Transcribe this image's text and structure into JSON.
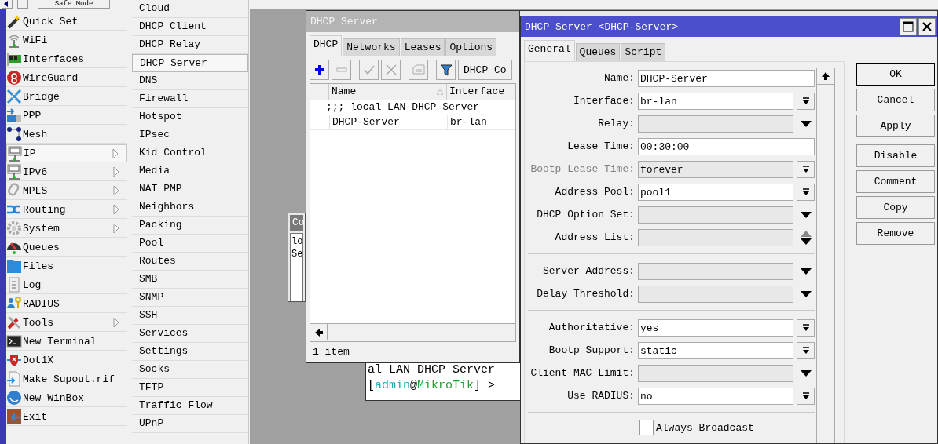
{
  "toolbar": {
    "safe_mode": "Safe Mode"
  },
  "main_menu": [
    {
      "label": "Quick Set",
      "has_submenu": false,
      "selected": false
    },
    {
      "label": "WiFi",
      "has_submenu": false,
      "selected": false
    },
    {
      "label": "Interfaces",
      "has_submenu": false,
      "selected": false
    },
    {
      "label": "WireGuard",
      "has_submenu": false,
      "selected": false
    },
    {
      "label": "Bridge",
      "has_submenu": false,
      "selected": false
    },
    {
      "label": "PPP",
      "has_submenu": false,
      "selected": false
    },
    {
      "label": "Mesh",
      "has_submenu": false,
      "selected": false
    },
    {
      "label": "IP",
      "has_submenu": true,
      "selected": true
    },
    {
      "label": "IPv6",
      "has_submenu": true,
      "selected": false
    },
    {
      "label": "MPLS",
      "has_submenu": true,
      "selected": false
    },
    {
      "label": "Routing",
      "has_submenu": true,
      "selected": false
    },
    {
      "label": "System",
      "has_submenu": true,
      "selected": false
    },
    {
      "label": "Queues",
      "has_submenu": false,
      "selected": false
    },
    {
      "label": "Files",
      "has_submenu": false,
      "selected": false
    },
    {
      "label": "Log",
      "has_submenu": false,
      "selected": false
    },
    {
      "label": "RADIUS",
      "has_submenu": false,
      "selected": false
    },
    {
      "label": "Tools",
      "has_submenu": true,
      "selected": false
    },
    {
      "label": "New Terminal",
      "has_submenu": false,
      "selected": false
    },
    {
      "label": "Dot1X",
      "has_submenu": false,
      "selected": false
    },
    {
      "label": "Make Supout.rif",
      "has_submenu": false,
      "selected": false
    },
    {
      "label": "New WinBox",
      "has_submenu": false,
      "selected": false
    },
    {
      "label": "Exit",
      "has_submenu": false,
      "selected": false
    }
  ],
  "submenu": [
    {
      "label": "Cloud",
      "selected": false
    },
    {
      "label": "DHCP Client",
      "selected": false
    },
    {
      "label": "DHCP Relay",
      "selected": false
    },
    {
      "label": "DHCP Server",
      "selected": true
    },
    {
      "label": "DNS",
      "selected": false
    },
    {
      "label": "Firewall",
      "selected": false
    },
    {
      "label": "Hotspot",
      "selected": false
    },
    {
      "label": "IPsec",
      "selected": false
    },
    {
      "label": "Kid Control",
      "selected": false
    },
    {
      "label": "Media",
      "selected": false
    },
    {
      "label": "NAT PMP",
      "selected": false
    },
    {
      "label": "Neighbors",
      "selected": false
    },
    {
      "label": "Packing",
      "selected": false
    },
    {
      "label": "Pool",
      "selected": false
    },
    {
      "label": "Routes",
      "selected": false
    },
    {
      "label": "SMB",
      "selected": false
    },
    {
      "label": "SNMP",
      "selected": false
    },
    {
      "label": "SSH",
      "selected": false
    },
    {
      "label": "Services",
      "selected": false
    },
    {
      "label": "Settings",
      "selected": false
    },
    {
      "label": "Socks",
      "selected": false
    },
    {
      "label": "TFTP",
      "selected": false
    },
    {
      "label": "Traffic Flow",
      "selected": false
    },
    {
      "label": "UPnP",
      "selected": false
    }
  ],
  "comment_window": {
    "title": "Co",
    "lines": [
      "lo",
      "Se"
    ]
  },
  "terminal": {
    "lines": [
      [
        {
          "text": "al LAN DHCP Server"
        }
      ],
      [
        {
          "text": "["
        },
        {
          "text": "admin",
          "color": "#1ba8b0"
        },
        {
          "text": "@"
        },
        {
          "text": "MikroTik",
          "color": "#22a032"
        },
        {
          "text": "] >"
        }
      ]
    ]
  },
  "list_window": {
    "title": "DHCP Server",
    "tabs": [
      {
        "label": "DHCP",
        "selected": true
      },
      {
        "label": "Networks",
        "selected": false
      },
      {
        "label": "Leases",
        "selected": false
      },
      {
        "label": "Options",
        "selected": false
      }
    ],
    "tool_buttons": [
      {
        "disabled": false
      },
      {
        "disabled": true
      },
      {
        "disabled": true
      },
      {
        "disabled": true
      },
      {
        "disabled": true
      },
      {
        "disabled": false
      }
    ],
    "toolbar_button": "DHCP Co",
    "columns": [
      "Name",
      "Interface"
    ],
    "rows": [
      {
        "kind": "comment",
        "text": ";;; local LAN DHCP Server"
      },
      {
        "kind": "entry",
        "cells": [
          "DHCP-Server",
          "br-lan"
        ]
      }
    ],
    "status": "1 item"
  },
  "dialog": {
    "title": "DHCP Server <DHCP-Server>",
    "tabs": [
      {
        "label": "General",
        "selected": true
      },
      {
        "label": "Queues",
        "selected": false
      },
      {
        "label": "Script",
        "selected": false
      }
    ],
    "groups": [
      [
        {
          "label": "Name:",
          "kind": "text",
          "value": "DHCP-Server",
          "disabled": false
        },
        {
          "label": "Interface:",
          "kind": "combo",
          "value": "br-lan",
          "disabled": false
        },
        {
          "label": "Relay:",
          "kind": "optional",
          "disabled": false
        },
        {
          "label": "Lease Time:",
          "kind": "text",
          "value": "00:30:00",
          "disabled": false
        },
        {
          "label": "Bootp Lease Time:",
          "kind": "combo",
          "value": "forever",
          "disabled": true
        },
        {
          "label": "Address Pool:",
          "kind": "combo",
          "value": "pool1",
          "disabled": false
        },
        {
          "label": "DHCP Option Set:",
          "kind": "optional",
          "disabled": false
        },
        {
          "label": "Address List:",
          "kind": "list",
          "disabled": false
        }
      ],
      [
        {
          "label": "Server Address:",
          "kind": "optional",
          "disabled": false
        },
        {
          "label": "Delay Threshold:",
          "kind": "optional",
          "disabled": false
        }
      ],
      [
        {
          "label": "Authoritative:",
          "kind": "combo",
          "value": "yes",
          "disabled": false
        },
        {
          "label": "Bootp Support:",
          "kind": "combo",
          "value": "static",
          "disabled": false
        },
        {
          "label": "Client MAC Limit:",
          "kind": "optional",
          "disabled": false
        },
        {
          "label": "Use RADIUS:",
          "kind": "combo",
          "value": "no",
          "disabled": false
        }
      ]
    ],
    "checkbox": {
      "label": "Always Broadcast",
      "checked": false
    },
    "buttons": [
      {
        "label": "OK",
        "default": true
      },
      {
        "label": "Cancel",
        "default": false
      },
      {
        "label": "Apply",
        "default": false
      },
      {
        "label": "Disable",
        "default": false
      },
      {
        "label": "Comment",
        "default": false
      },
      {
        "label": "Copy",
        "default": false
      },
      {
        "label": "Remove",
        "default": false
      }
    ]
  }
}
